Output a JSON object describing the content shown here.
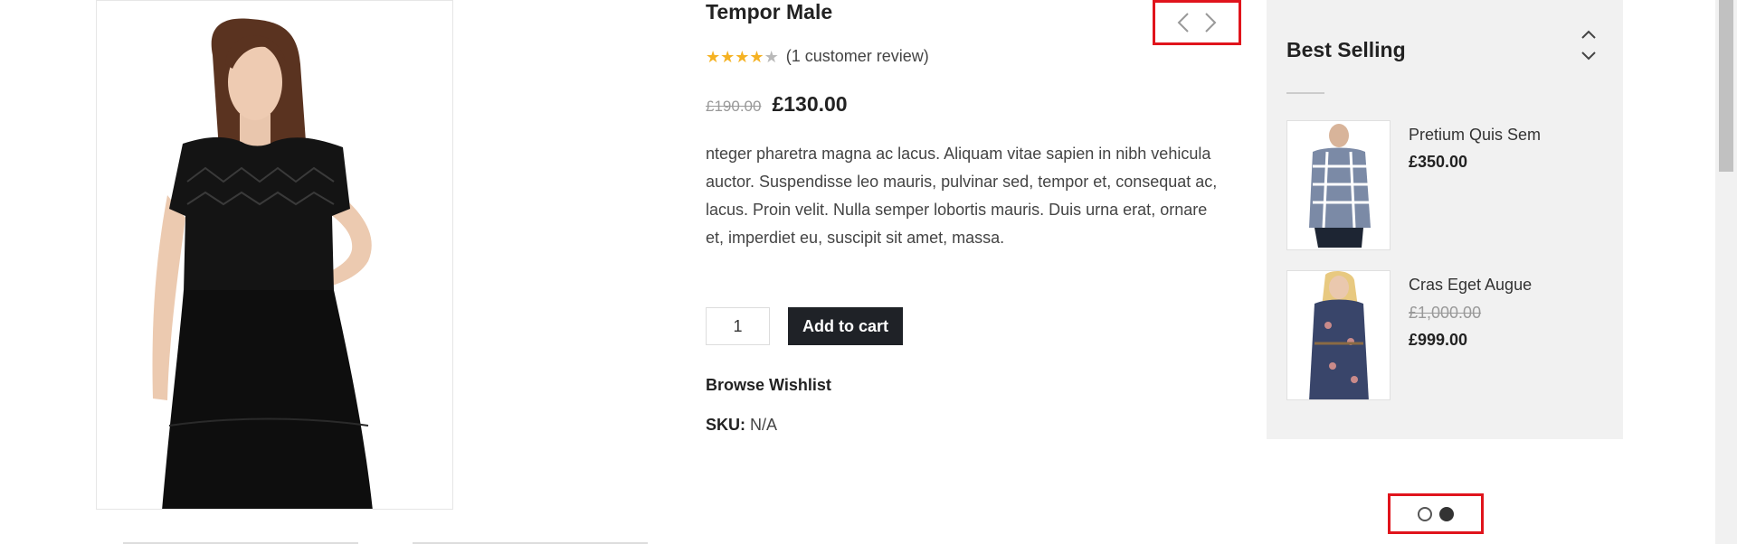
{
  "product": {
    "title": "Tempor Male",
    "rating": 4.5,
    "review_text": "(1 customer review)",
    "old_price": "£190.00",
    "price": "£130.00",
    "description": "nteger pharetra magna ac lacus. Aliquam vitae sapien in nibh vehicula auctor. Suspendisse leo mauris, pulvinar sed, tempor et, consequat ac, lacus. Proin velit. Nulla semper lobortis mauris. Duis urna erat, ornare et, imperdiet eu, suscipit sit amet, massa.",
    "quantity": "1",
    "add_to_cart_label": "Add to cart",
    "wishlist_label": "Browse Wishlist",
    "sku_label": "SKU:",
    "sku_value": "N/A"
  },
  "nav": {
    "prev_icon": "chevron-left-icon",
    "next_icon": "chevron-right-icon"
  },
  "widget": {
    "title": "Best Selling",
    "items": [
      {
        "name": "Pretium Quis Sem",
        "old_price": "",
        "price": "£350.00"
      },
      {
        "name": "Cras Eget Augue",
        "old_price": "£1,000.00",
        "price": "£999.00"
      }
    ]
  },
  "pagination": {
    "total": 2,
    "active": 2
  },
  "colors": {
    "highlight": "#e0141c",
    "star": "#f5b223",
    "button": "#1f2227",
    "widget_bg": "#f1f1f1"
  }
}
